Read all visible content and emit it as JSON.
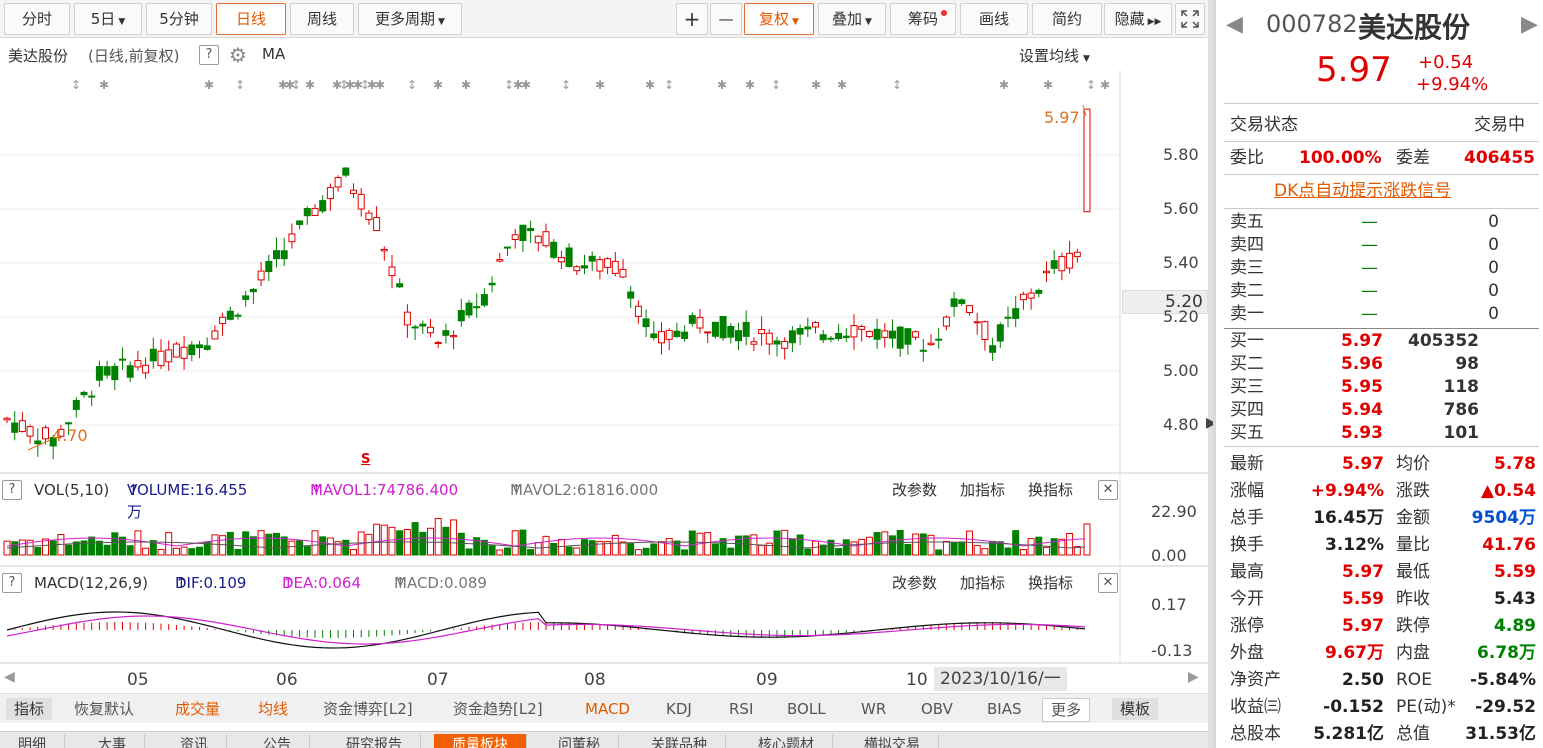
{
  "toolbar": {
    "tabs": [
      "分时",
      "5日",
      "5分钟",
      "日线",
      "周线",
      "更多周期"
    ],
    "tools": [
      "+",
      "—",
      "复权",
      "叠加",
      "筹码",
      "画线",
      "简约",
      "隐藏"
    ],
    "expand_icon": "expand-icon",
    "colors": {
      "active": "#e05a00",
      "up": "#e00000",
      "down": "#008000"
    }
  },
  "title": {
    "stock": "美达股份",
    "mode": "(日线,前复权)",
    "help": "?",
    "ma": "MA",
    "set_ma": "设置均线"
  },
  "price_chart": {
    "max_label": "5.97",
    "min_label": "4.70",
    "s_marker": "S",
    "current_price_box": "5.20"
  },
  "vol_header": {
    "help": "?",
    "name": "VOL(5,10)",
    "volume": "VOLUME:16.455万",
    "mavol1": "MAVOL1:74786.400",
    "mavol2": "MAVOL2:61816.000",
    "btn1": "改参数",
    "btn2": "加指标",
    "btn3": "换指标",
    "close": "✕"
  },
  "macd_header": {
    "help": "?",
    "name": "MACD(12,26,9)",
    "dif": "DIF:0.109",
    "dea": "DEA:0.064",
    "macd": "MACD:0.089",
    "btn1": "改参数",
    "btn2": "加指标",
    "btn3": "换指标",
    "close": "✕"
  },
  "date_axis": {
    "months": [
      "05",
      "06",
      "07",
      "08",
      "09",
      "10"
    ],
    "cursor_date": "2023/10/16/一"
  },
  "bottom_bar": {
    "items": [
      "指标",
      "恢复默认",
      "成交量",
      "均线",
      "资金博弈[L2]",
      "资金趋势[L2]",
      "MACD",
      "KDJ",
      "RSI",
      "BOLL",
      "WR",
      "OBV",
      "BIAS",
      "更多",
      "模板"
    ]
  },
  "tab_bar": {
    "items": [
      "明细",
      "大事",
      "资讯",
      "公告",
      "研究报告",
      "质量板块",
      "问董秘",
      "关联品种",
      "核心题材",
      "横拟交易"
    ]
  },
  "quote": {
    "code": "000782",
    "name": "美达股份",
    "price": "5.97",
    "change": "+0.54",
    "change_pct": "+9.94%",
    "status_label": "交易状态",
    "status_value": "交易中",
    "wb_label": "委比",
    "wb_value": "100.00%",
    "wc_label": "委差",
    "wc_value": "406455",
    "signal_link": "DK点自动提示涨跌信号",
    "sell": [
      {
        "label": "卖五",
        "price": "—",
        "vol": "0"
      },
      {
        "label": "卖四",
        "price": "—",
        "vol": "0"
      },
      {
        "label": "卖三",
        "price": "—",
        "vol": "0"
      },
      {
        "label": "卖二",
        "price": "—",
        "vol": "0"
      },
      {
        "label": "卖一",
        "price": "—",
        "vol": "0"
      }
    ],
    "buy": [
      {
        "label": "买一",
        "price": "5.97",
        "vol": "405352"
      },
      {
        "label": "买二",
        "price": "5.96",
        "vol": "98"
      },
      {
        "label": "买三",
        "price": "5.95",
        "vol": "118"
      },
      {
        "label": "买四",
        "price": "5.94",
        "vol": "786"
      },
      {
        "label": "买五",
        "price": "5.93",
        "vol": "101"
      }
    ],
    "stats": [
      {
        "l1": "最新",
        "v1": "5.97",
        "c1": "red",
        "l2": "均价",
        "v2": "5.78",
        "c2": "red"
      },
      {
        "l1": "涨幅",
        "v1": "+9.94%",
        "c1": "red",
        "l2": "涨跌",
        "v2": "▲0.54",
        "c2": "red"
      },
      {
        "l1": "总手",
        "v1": "16.45万",
        "c1": "dark",
        "l2": "金额",
        "v2": "9504万",
        "c2": "blue"
      },
      {
        "l1": "换手",
        "v1": "3.12%",
        "c1": "dark",
        "l2": "量比",
        "v2": "41.76",
        "c2": "red"
      },
      {
        "l1": "最高",
        "v1": "5.97",
        "c1": "red",
        "l2": "最低",
        "v2": "5.59",
        "c2": "red"
      },
      {
        "l1": "今开",
        "v1": "5.59",
        "c1": "red",
        "l2": "昨收",
        "v2": "5.43",
        "c2": "dark"
      },
      {
        "l1": "涨停",
        "v1": "5.97",
        "c1": "red",
        "l2": "跌停",
        "v2": "4.89",
        "c2": "green"
      },
      {
        "l1": "外盘",
        "v1": "9.67万",
        "c1": "red",
        "l2": "内盘",
        "v2": "6.78万",
        "c2": "green"
      },
      {
        "l1": "净资产",
        "v1": "2.50",
        "c1": "dark",
        "l2": "ROE",
        "v2": "-5.84%",
        "c2": "dark"
      },
      {
        "l1": "收益㈢",
        "v1": "-0.152",
        "c1": "dark",
        "l2": "PE(动)*",
        "v2": "-29.52",
        "c2": "dark"
      },
      {
        "l1": "总股本",
        "v1": "5.281亿",
        "c1": "dark",
        "l2": "总值",
        "v2": "31.53亿",
        "c2": "dark"
      }
    ]
  },
  "chart_data": {
    "type": "candlestick",
    "y_ticks": [
      "5.80",
      "5.60",
      "5.40",
      "5.20",
      "5.00",
      "4.80"
    ],
    "y_range": [
      4.7,
      5.97
    ],
    "vol_ticks": [
      "22.90",
      "0.00"
    ],
    "macd_ticks": [
      "0.17",
      "-0.13"
    ],
    "last_candle": {
      "open": 5.59,
      "high": 5.97,
      "low": 5.59,
      "close": 5.97
    }
  }
}
